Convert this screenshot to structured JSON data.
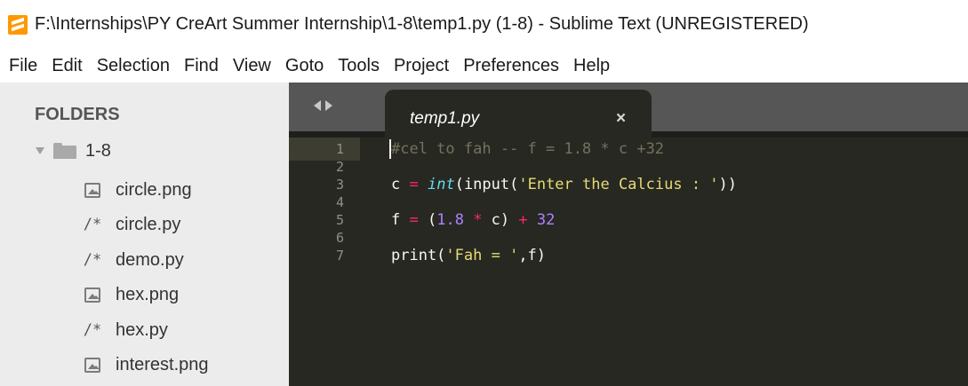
{
  "window": {
    "title": "F:\\Internships\\PY CreArt Summer Internship\\1-8\\temp1.py (1-8) - Sublime Text (UNREGISTERED)",
    "app_icon": "sublime-text-icon"
  },
  "menu": [
    "File",
    "Edit",
    "Selection",
    "Find",
    "View",
    "Goto",
    "Tools",
    "Project",
    "Preferences",
    "Help"
  ],
  "sidebar": {
    "header": "FOLDERS",
    "folder": "1-8",
    "files": [
      {
        "name": "circle.png",
        "icon": "image-file-icon"
      },
      {
        "name": "circle.py",
        "icon": "code-file-icon"
      },
      {
        "name": "demo.py",
        "icon": "code-file-icon"
      },
      {
        "name": "hex.png",
        "icon": "image-file-icon"
      },
      {
        "name": "hex.py",
        "icon": "code-file-icon"
      },
      {
        "name": "interest.png",
        "icon": "image-file-icon"
      }
    ]
  },
  "editor": {
    "tab": {
      "label": "temp1.py",
      "close": "×"
    },
    "lines": [
      "1",
      "2",
      "3",
      "4",
      "5",
      "6",
      "7"
    ],
    "code": {
      "l1": "#cel to fah -- f = 1.8 * c +32",
      "l3": {
        "a": "c ",
        "b": "=",
        "c": " ",
        "d": "int",
        "e": "(input(",
        "f": "'Enter the Calcius : '",
        "g": "))"
      },
      "l5": {
        "a": "f ",
        "b": "=",
        "c": " (",
        "d": "1.8",
        "e": " ",
        "f": "*",
        "g": " c) ",
        "h": "+",
        "i": " ",
        "j": "32"
      },
      "l7": {
        "a": "print(",
        "b": "'Fah = '",
        "c": ",f)"
      }
    }
  },
  "colors": {
    "editor_bg": "#272822",
    "sidebar_bg": "#ececec",
    "keyword": "#f92672",
    "builtin": "#66d9ef",
    "string": "#e6db74",
    "number": "#ae81ff",
    "comment": "#75715e"
  }
}
